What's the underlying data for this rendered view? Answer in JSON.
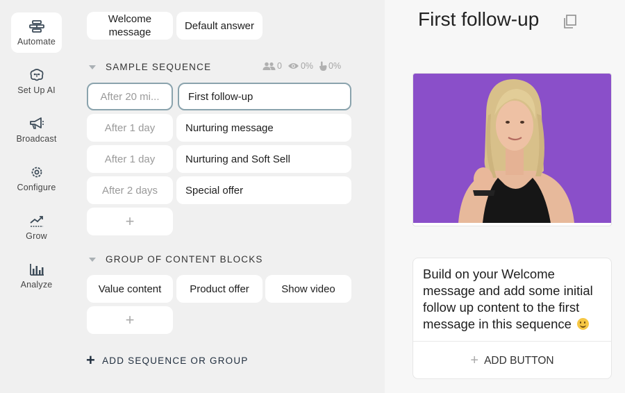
{
  "sidebar": {
    "items": [
      {
        "label": "Automate",
        "icon": "automate-icon",
        "active": true
      },
      {
        "label": "Set Up AI",
        "icon": "ai-brain-icon"
      },
      {
        "label": "Broadcast",
        "icon": "megaphone-icon"
      },
      {
        "label": "Configure",
        "icon": "gear-icon"
      },
      {
        "label": "Grow",
        "icon": "trend-up-icon"
      },
      {
        "label": "Analyze",
        "icon": "bar-chart-icon"
      }
    ]
  },
  "top_tiles": {
    "welcome": "Welcome message",
    "default": "Default answer"
  },
  "sequence": {
    "title": "SAMPLE SEQUENCE",
    "stats": {
      "users": "0",
      "views": "0%",
      "clicks": "0%"
    },
    "rows": [
      {
        "delay": "After 20 mi...",
        "name": "First follow-up"
      },
      {
        "delay": "After 1 day",
        "name": "Nurturing message"
      },
      {
        "delay": "After 1 day",
        "name": "Nurturing and Soft Sell"
      },
      {
        "delay": "After 2 days",
        "name": "Special offer"
      }
    ],
    "add": "+"
  },
  "group": {
    "title": "GROUP OF CONTENT BLOCKS",
    "blocks": [
      "Value content",
      "Product offer",
      "Show video"
    ],
    "add": "+"
  },
  "add_sequence": "ADD SEQUENCE OR GROUP",
  "editor": {
    "title": "First follow-up",
    "text": "Build on your Welcome message and add some initial follow up content to the first message in this sequence",
    "add_button": "ADD BUTTON"
  },
  "colors": {
    "accent": "#8aa3ad",
    "image_bg": "#8a4fc9"
  }
}
